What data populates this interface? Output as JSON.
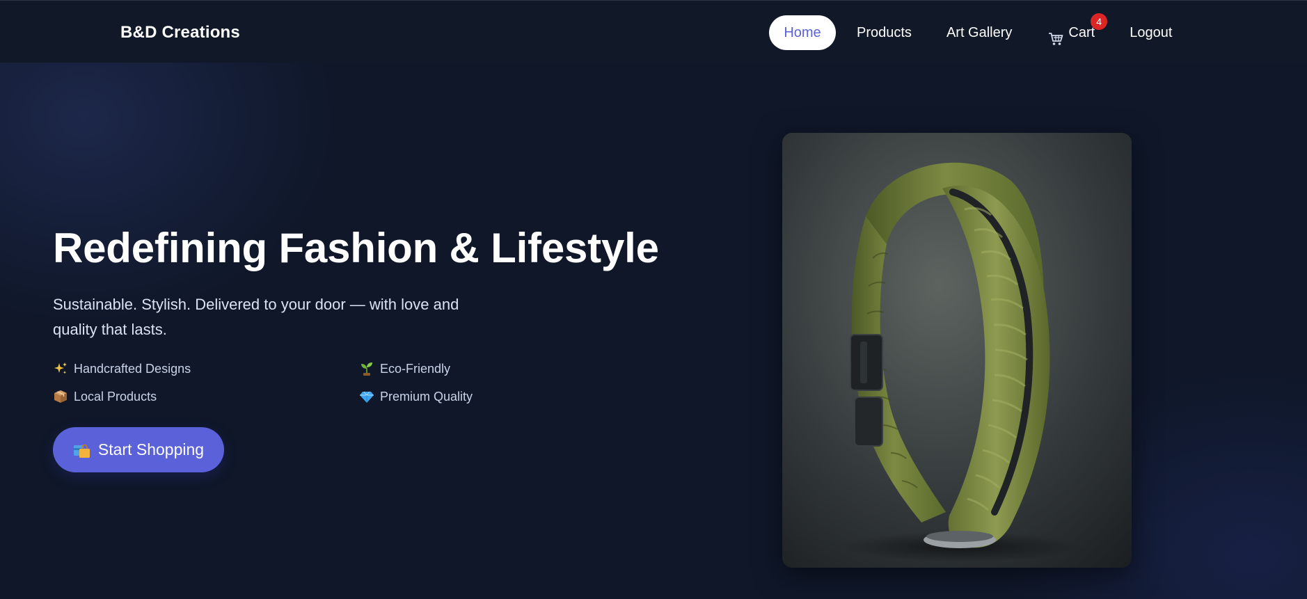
{
  "brand": {
    "name": "B&D Creations"
  },
  "nav": {
    "home": "Home",
    "products": "Products",
    "gallery": "Art Gallery",
    "cart": "Cart",
    "cart_count": "4",
    "logout": "Logout"
  },
  "hero": {
    "title": "Redefining Fashion & Lifestyle",
    "subtitle": "Sustainable. Stylish. Delivered to your door — with love and quality that lasts.",
    "features": [
      {
        "label": "Handcrafted Designs",
        "icon": "sparkles-icon"
      },
      {
        "label": "Eco-Friendly",
        "icon": "seedling-icon"
      },
      {
        "label": "Local Products",
        "icon": "package-icon"
      },
      {
        "label": "Premium Quality",
        "icon": "gem-icon"
      }
    ],
    "cta_label": "Start Shopping",
    "cta_icon": "shopping-bags-icon"
  },
  "colors": {
    "background": "#0f1729",
    "navbar": "#111827",
    "accent": "#5b61d8",
    "badge": "#dc2626"
  }
}
